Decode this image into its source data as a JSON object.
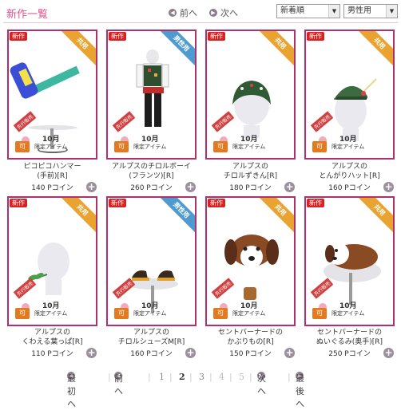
{
  "header": {
    "title": "新作一覧",
    "prev_label": "前へ",
    "next_label": "次へ",
    "sort_select": "新着順",
    "gender_select": "男性用"
  },
  "items": [
    {
      "badge": "新作",
      "ribbon": "共用",
      "name_line1": "ピコピコハンマー",
      "name_line2": "(手前)[R]",
      "price": "140 Pコイン"
    },
    {
      "badge": "新作",
      "ribbon": "男性用",
      "name_line1": "アルプスのチロルボーイ",
      "name_line2": "(フランツ)[R]",
      "price": "260 Pコイン"
    },
    {
      "badge": "新作",
      "ribbon": "共用",
      "name_line1": "アルプスの",
      "name_line2": "チロルずきん[R]",
      "price": "180 Pコイン"
    },
    {
      "badge": "新作",
      "ribbon": "共用",
      "name_line1": "アルプスの",
      "name_line2": "とんがりハット[R]",
      "price": "160 Pコイン"
    },
    {
      "badge": "新作",
      "ribbon": "共用",
      "name_line1": "アルプスの",
      "name_line2": "くわえる葉っぱ[R]",
      "price": "110 Pコイン"
    },
    {
      "badge": "新作",
      "ribbon": "男性用",
      "name_line1": "アルプスの",
      "name_line2": "チロルシューズM[R]",
      "price": "160 Pコイン"
    },
    {
      "badge": "新作",
      "ribbon": "共用",
      "name_line1": "セントバーナードの",
      "name_line2": "かぶりもの[R]",
      "price": "150 Pコイン"
    },
    {
      "badge": "新作",
      "ribbon": "共用",
      "name_line1": "セントバーナードの",
      "name_line2": "ぬいぐるみ(奥手)[R]",
      "price": "250 Pコイン"
    }
  ],
  "promo": {
    "tag": "先行販売",
    "month": "10月",
    "limited": "限定アイテム",
    "trade": "可"
  },
  "pagination": {
    "first": "最初へ",
    "prev": "前へ",
    "pages": [
      "1",
      "2",
      "3",
      "4",
      "5"
    ],
    "current": "2",
    "next": "次へ",
    "last": "最後へ"
  },
  "colors": {
    "accent": "#e0508c",
    "card_border": "#b0306c",
    "ribbon_shared": "#e8a330",
    "ribbon_male": "#4f9bcf",
    "new_badge": "#d82222"
  }
}
